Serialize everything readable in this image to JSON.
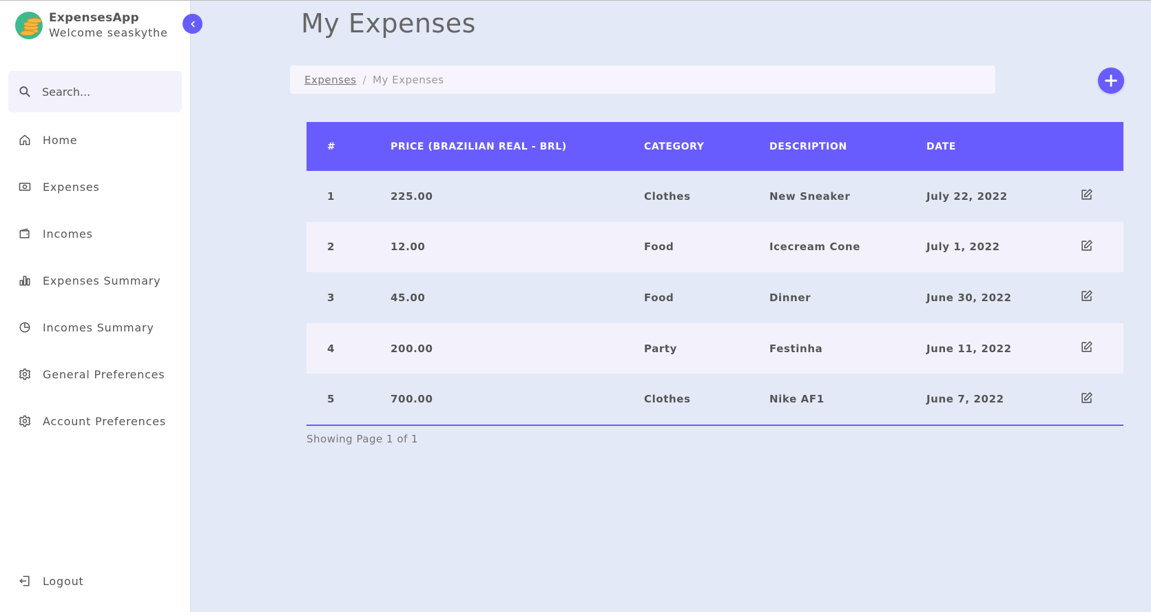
{
  "app": {
    "name": "ExpensesApp",
    "welcome": "Welcome seaskythe"
  },
  "sidebar": {
    "search_placeholder": "Search...",
    "items": [
      {
        "label": "Home",
        "icon": "home-icon"
      },
      {
        "label": "Expenses",
        "icon": "money-icon"
      },
      {
        "label": "Incomes",
        "icon": "wallet-icon"
      },
      {
        "label": "Expenses Summary",
        "icon": "bar-chart-icon"
      },
      {
        "label": "Incomes Summary",
        "icon": "pie-chart-icon"
      },
      {
        "label": "General Preferences",
        "icon": "gear-icon"
      },
      {
        "label": "Account Preferences",
        "icon": "gear-icon"
      }
    ],
    "logout": "Logout"
  },
  "page": {
    "title": "My Expenses",
    "breadcrumb": {
      "link": "Expenses",
      "separator": "/",
      "current": "My Expenses"
    }
  },
  "table": {
    "headers": [
      "#",
      "PRICE (BRAZILIAN REAL - BRL)",
      "CATEGORY",
      "DESCRIPTION",
      "DATE"
    ],
    "rows": [
      {
        "num": "1",
        "price": "225.00",
        "category": "Clothes",
        "description": "New Sneaker",
        "date": "July 22, 2022"
      },
      {
        "num": "2",
        "price": "12.00",
        "category": "Food",
        "description": "Icecream Cone",
        "date": "July 1, 2022"
      },
      {
        "num": "3",
        "price": "45.00",
        "category": "Food",
        "description": "Dinner",
        "date": "June 30, 2022"
      },
      {
        "num": "4",
        "price": "200.00",
        "category": "Party",
        "description": "Festinha",
        "date": "June 11, 2022"
      },
      {
        "num": "5",
        "price": "700.00",
        "category": "Clothes",
        "description": "Nike AF1",
        "date": "June 7, 2022"
      }
    ]
  },
  "pagination": {
    "text": "Showing Page 1 of 1"
  },
  "colors": {
    "accent": "#695cfe",
    "background": "#e4e9f7",
    "row_alt": "#f3f2fc"
  }
}
